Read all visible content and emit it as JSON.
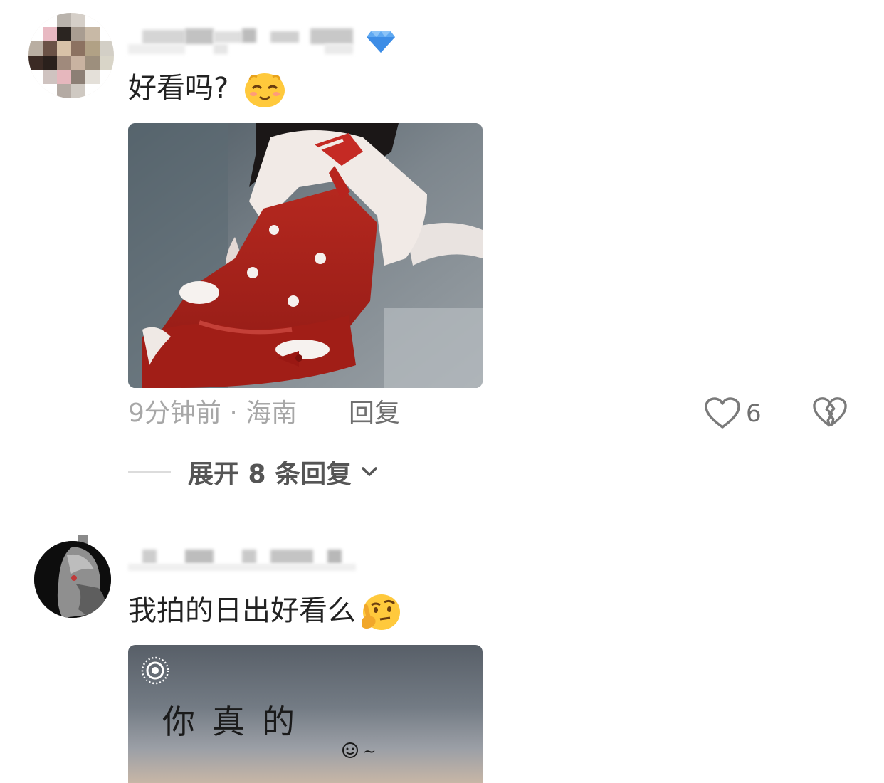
{
  "comment1": {
    "text": "好看吗?",
    "meta": "9分钟前 · 海南",
    "reply_label": "回复",
    "like_count": "6",
    "expand_label": "展开 8 条回复",
    "emoji": "smiling-face-emoji",
    "photo": "red-lolita-dress-photo"
  },
  "comment2": {
    "text": "我拍的日出好看么",
    "emoji": "thinking-face-emoji",
    "photo": "sunrise-sky-photo",
    "photo_caption": "你真的"
  },
  "colors": {
    "text": "#222222",
    "meta": "#a7a7a7",
    "action": "#6f6f6f",
    "background": "#ffffff"
  }
}
